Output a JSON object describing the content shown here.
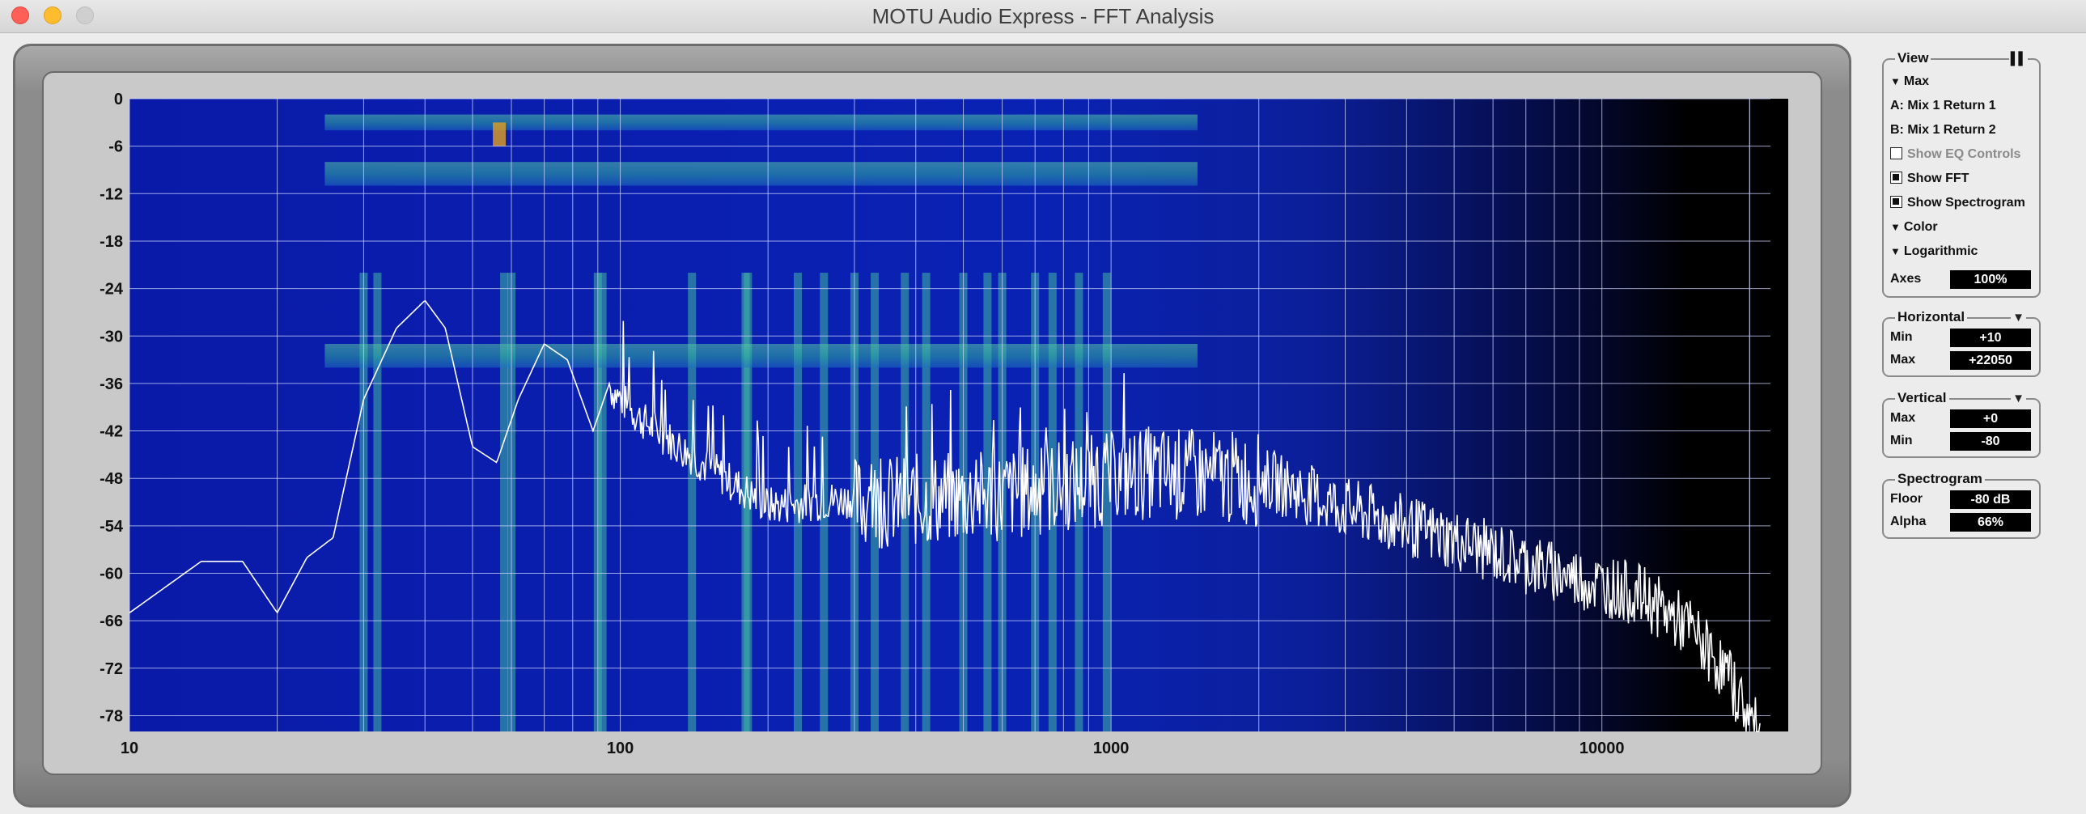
{
  "window": {
    "title": "MOTU Audio Express - FFT Analysis"
  },
  "plot": {
    "y_ticks": [
      "0",
      "-6",
      "-12",
      "-18",
      "-24",
      "-30",
      "-36",
      "-42",
      "-48",
      "-54",
      "-60",
      "-66",
      "-72",
      "-78"
    ],
    "x_ticks": [
      "10",
      "100",
      "1000",
      "10000"
    ],
    "x_scale": "log",
    "x_range": [
      10,
      22050
    ],
    "y_range": [
      -80,
      0
    ],
    "grid": true,
    "fft_color": "#ffffff"
  },
  "view": {
    "title": "View",
    "max_label": "Max",
    "trace_a": "A: Mix 1 Return 1",
    "trace_b": "B: Mix 1 Return 2",
    "show_eq": "Show EQ Controls",
    "show_eq_checked": false,
    "show_fft": "Show FFT",
    "show_fft_checked": true,
    "show_spectrogram": "Show Spectrogram",
    "show_spectrogram_checked": true,
    "color_label": "Color",
    "log_label": "Logarithmic",
    "axes_label": "Axes",
    "axes_value": "100%"
  },
  "horizontal": {
    "title": "Horizontal",
    "min_label": "Min",
    "min_value": "+10",
    "max_label": "Max",
    "max_value": "+22050"
  },
  "vertical": {
    "title": "Vertical",
    "max_label": "Max",
    "max_value": "+0",
    "min_label": "Min",
    "min_value": "-80"
  },
  "spectrogram": {
    "title": "Spectrogram",
    "floor_label": "Floor",
    "floor_value": "-80 dB",
    "alpha_label": "Alpha",
    "alpha_value": "66%"
  }
}
